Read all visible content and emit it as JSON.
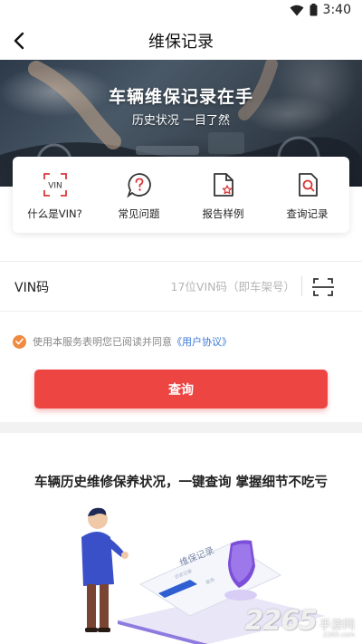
{
  "status_bar": {
    "time": "3:40",
    "icons": [
      "wifi-icon",
      "battery-icon"
    ]
  },
  "nav": {
    "title": "维保记录",
    "back_icon": "chevron-left-icon"
  },
  "banner": {
    "title": "车辆维保记录在手",
    "subtitle": "历史状况 一目了然"
  },
  "shortcuts": [
    {
      "label": "什么是VIN?",
      "icon": "vin-frame-icon"
    },
    {
      "label": "常见问题",
      "icon": "question-bubble-icon"
    },
    {
      "label": "报告样例",
      "icon": "document-star-icon"
    },
    {
      "label": "查询记录",
      "icon": "document-search-icon"
    }
  ],
  "vin": {
    "label": "VIN码",
    "placeholder": "17位VIN码（即车架号）",
    "value": "",
    "scan_icon": "scan-frame-icon"
  },
  "agreement": {
    "checked": true,
    "text": "使用本服务表明您已阅读并同意",
    "link": "《用户协议》"
  },
  "query_button": {
    "label": "查询"
  },
  "promo": {
    "title": "车辆历史维修保养状况，一键查询 掌握细节不吃亏"
  },
  "illustration": {
    "card_text": "维保记录",
    "card_small_a": "历史记录",
    "card_small_b": "查询"
  },
  "watermark": {
    "number": "2265",
    "dot": ".",
    "site": "手游网",
    "url": "2265.com"
  },
  "colors": {
    "accent": "#ec4542",
    "check": "#ef8a41",
    "link": "#3a78d8",
    "icon_red": "#d9383a"
  }
}
